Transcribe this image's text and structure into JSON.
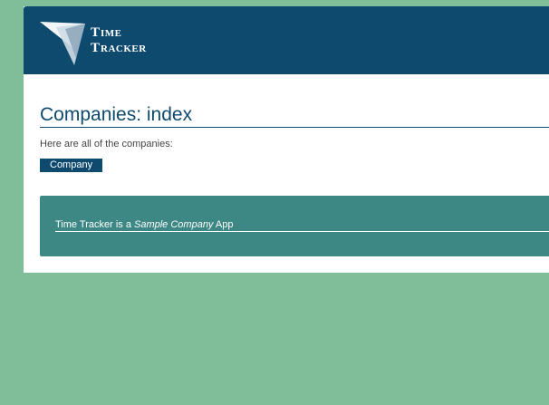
{
  "header": {
    "logo_text_line1": "Time",
    "logo_text_line2": "Tracker"
  },
  "main": {
    "title": "Companies: index",
    "intro": "Here are all of the companies:",
    "company_button_label": "Company"
  },
  "footer": {
    "text_prefix": "Time Tracker is a ",
    "text_emphasis": "Sample Company",
    "text_suffix": " App"
  },
  "colors": {
    "background": "#7fbe98",
    "header": "#0e4a6e",
    "footer": "#3d8784",
    "button": "#0e4a6e"
  }
}
